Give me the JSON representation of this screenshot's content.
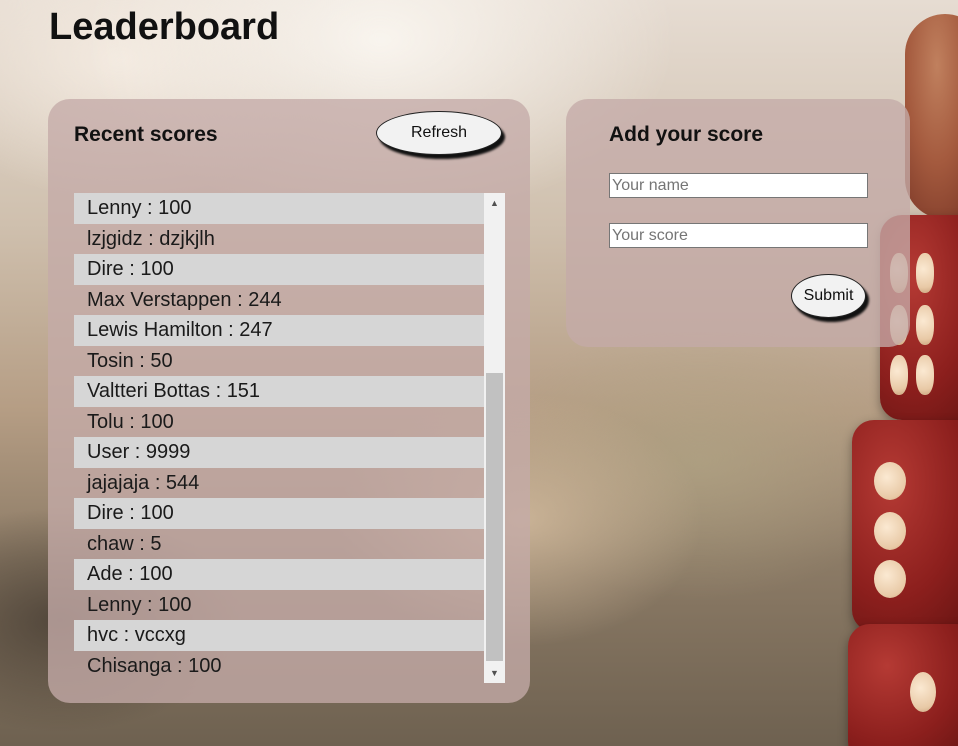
{
  "page": {
    "title": "Leaderboard"
  },
  "recent_scores": {
    "heading": "Recent scores",
    "refresh_label": "Refresh",
    "items": [
      "Lenny : 100",
      "lzjgidz : dzjkjlh",
      "Dire : 100",
      "Max Verstappen : 244",
      "Lewis Hamilton : 247",
      "Tosin : 50",
      "Valtteri Bottas : 151",
      "Tolu : 100",
      "User : 9999",
      "jajajaja : 544",
      "Dire : 100",
      "chaw : 5",
      "Ade : 100",
      "Lenny : 100",
      "hvc : vccxg",
      "Chisanga : 100"
    ],
    "scroll_up_icon": "triangle-up",
    "scroll_down_icon": "triangle-down"
  },
  "add_score": {
    "heading": "Add your score",
    "name_value": "",
    "name_placeholder": "Your name",
    "score_value": "",
    "score_placeholder": "Your score",
    "submit_label": "Submit"
  },
  "colors": {
    "panel_background": "#c4aaa8",
    "row_highlight": "#d6d6d6",
    "dice_red": "#8c1f1d",
    "pip_cream": "#f0d8bc"
  }
}
